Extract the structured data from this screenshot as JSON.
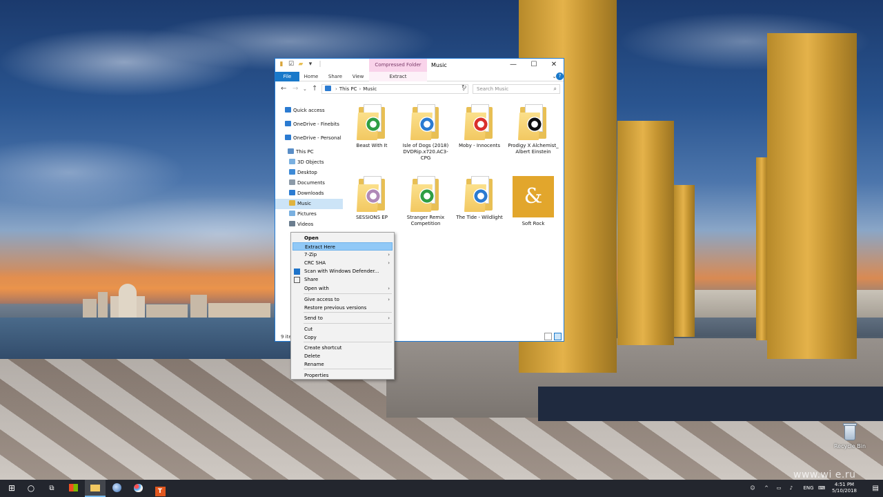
{
  "window": {
    "title": "Music",
    "contextual_tab_group": "Compressed Folder Tools",
    "controls": {
      "minimize": "—",
      "maximize": "☐",
      "close": "✕"
    }
  },
  "ribbon": {
    "tabs": [
      "File",
      "Home",
      "Share",
      "View",
      "Extract"
    ]
  },
  "address": {
    "crumbs": [
      "This PC",
      "Music"
    ],
    "search_placeholder": "Search Music"
  },
  "navpane": {
    "items": [
      {
        "label": "Quick access",
        "icon": "star-icon",
        "color": "#2b7bd1"
      },
      {
        "label": "OneDrive - Finebits",
        "icon": "cloud-icon",
        "color": "#2b7bd1"
      },
      {
        "label": "OneDrive - Personal",
        "icon": "cloud-icon",
        "color": "#2b7bd1"
      },
      {
        "label": "This PC",
        "icon": "computer-icon",
        "color": "#5a8ec7"
      },
      {
        "label": "3D Objects",
        "icon": "cube-icon",
        "color": "#7ab0e0"
      },
      {
        "label": "Desktop",
        "icon": "desktop-icon",
        "color": "#3e8ad6"
      },
      {
        "label": "Documents",
        "icon": "document-icon",
        "color": "#8c9aa8"
      },
      {
        "label": "Downloads",
        "icon": "download-icon",
        "color": "#2b7bd1"
      },
      {
        "label": "Music",
        "icon": "music-icon",
        "color": "#e0b33e"
      },
      {
        "label": "Pictures",
        "icon": "picture-icon",
        "color": "#7ab0e0"
      },
      {
        "label": "Videos",
        "icon": "video-icon",
        "color": "#6b7d8f"
      }
    ],
    "selected_index": 8
  },
  "files": [
    {
      "name": "Beast With It",
      "badge": "chrome-icon",
      "badge_color": "#2f9e44"
    },
    {
      "name": "Isle of Dogs (2018) DVDRip.x720.AC3-CPG",
      "badge": "media-icon",
      "badge_color": "#2b7bd1"
    },
    {
      "name": "Moby - Innocents",
      "badge": "pdf-icon",
      "badge_color": "#d9302c"
    },
    {
      "name": "Prodigy X Alchemist_ Albert Einstein",
      "badge": "photo-icon",
      "badge_color": "#111111"
    },
    {
      "name": "SESSIONS EP",
      "badge": "album-icon",
      "badge_color": "#b08ab8"
    },
    {
      "name": "Stranger Remix Competition",
      "badge": "chrome-icon",
      "badge_color": "#2f9e44"
    },
    {
      "name": "The Tide - Wildlight",
      "badge": "media-icon",
      "badge_color": "#2b7bd1"
    },
    {
      "name": "Soft Rock",
      "badge": "ampersand-tile",
      "badge_color": "#e2a62c",
      "tile_glyph": "&"
    }
  ],
  "status": {
    "items_text": "9 ite"
  },
  "context_menu": {
    "items": [
      {
        "label": "Open",
        "bold": true
      },
      {
        "label": "Extract Here",
        "highlighted": true
      },
      {
        "label": "7-Zip",
        "submenu": true
      },
      {
        "label": "CRC SHA",
        "submenu": true
      },
      {
        "label": "Scan with Windows Defender...",
        "icon": "defender-icon"
      },
      {
        "label": "Share",
        "icon": "share-icon"
      },
      {
        "label": "Open with",
        "submenu": true
      },
      {
        "label": "Give access to",
        "submenu": true
      },
      {
        "label": "Restore previous versions"
      },
      {
        "label": "Send to",
        "submenu": true
      },
      {
        "label": "Cut"
      },
      {
        "label": "Copy"
      },
      {
        "label": "Create shortcut"
      },
      {
        "label": "Delete"
      },
      {
        "label": "Rename"
      },
      {
        "label": "Properties"
      }
    ],
    "submenu_glyph": "›"
  },
  "desktop": {
    "recycle_bin_label": "Recycle Bin",
    "watermark": "www.wi  e.ru"
  },
  "taskbar": {
    "start_glyph": "⊞",
    "cortana_glyph": "○",
    "taskview_glyph": "⧉",
    "language": "ENG",
    "time": "4:51 PM",
    "date": "5/10/2018"
  }
}
